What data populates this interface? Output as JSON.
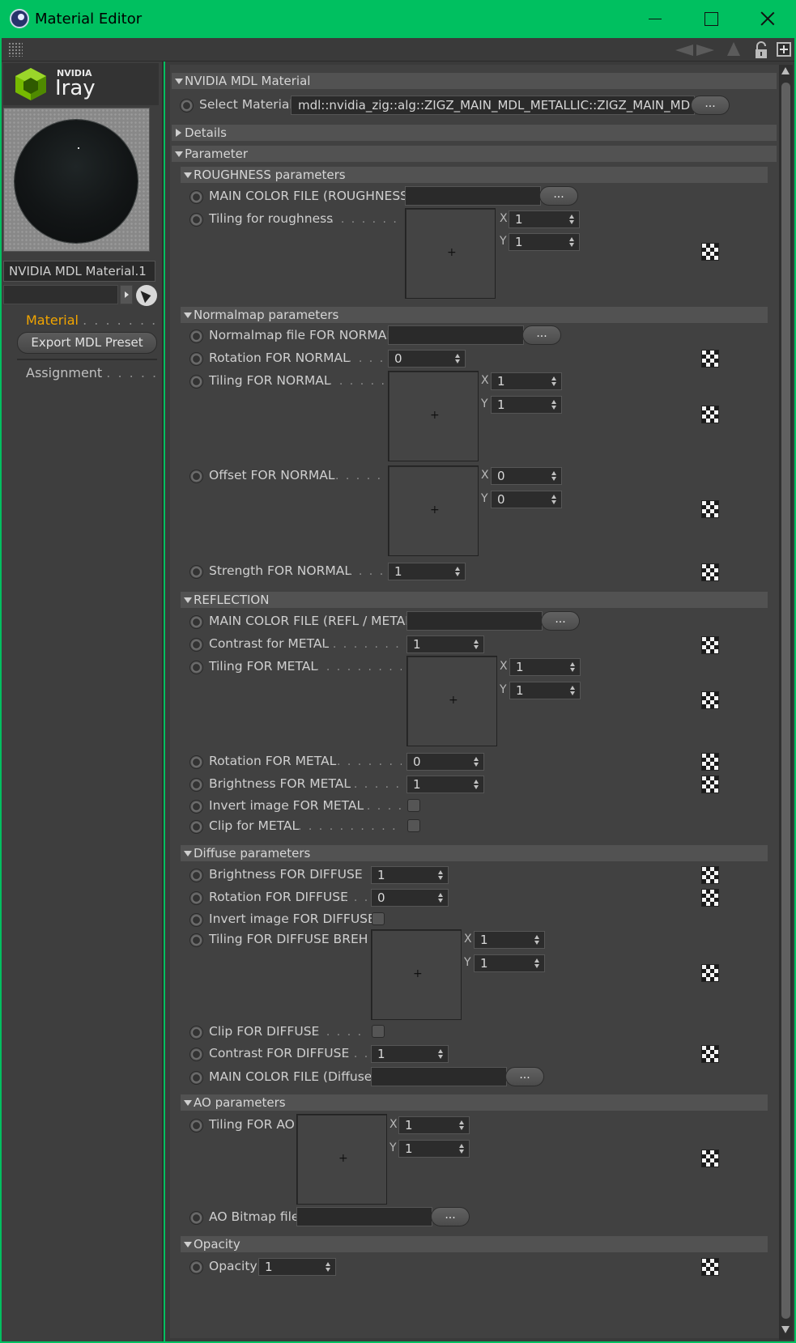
{
  "window": {
    "title": "Material Editor"
  },
  "left": {
    "logo_brand": "NVIDIA",
    "logo_product": "Iray",
    "material_name": "NVIDIA MDL Material.1",
    "nav_material": "Material",
    "nav_assignment": "Assignment",
    "dots_material": ". . . . . . . . .",
    "dots_assignment": ". . . . . . .",
    "export_button": "Export MDL Preset"
  },
  "main": {
    "g_nvidia": "NVIDIA MDL Material",
    "select_material_label": "Select Material",
    "select_material_value": "mdl::nvidia_zig::alg::ZIGZ_MAIN_MDL_METALLIC::ZIGZ_MAIN_MD",
    "ellipsis": "...",
    "g_details": "Details",
    "g_parameter": "Parameter",
    "g_roughness": "ROUGHNESS parameters",
    "g_normal": "Normalmap parameters",
    "g_reflection": "REFLECTION",
    "g_diffuse": "Diffuse parameters",
    "g_ao": "AO parameters",
    "g_opacity": "Opacity",
    "axis_x": "X",
    "axis_y": "Y",
    "plus": "+",
    "params": {
      "r_file": "MAIN COLOR FILE (ROUGHNESS)",
      "r_tiling": "Tiling for roughness",
      "n_file": "Normalmap file FOR NORMAL",
      "n_rotation": "Rotation FOR NORMAL",
      "n_tiling": "Tiling FOR NORMAL",
      "n_offset": "Offset FOR NORMAL",
      "n_strength": "Strength FOR NORMAL",
      "m_file": "MAIN COLOR FILE (REFL / METAL)",
      "m_contrast": "Contrast for METAL",
      "m_tiling": "Tiling FOR METAL",
      "m_rotation": "Rotation FOR METAL",
      "m_brightness": "Brightness FOR METAL",
      "m_invert": "Invert image FOR METAL",
      "m_clip": "Clip for METAL",
      "d_brightness": "Brightness FOR DIFFUSE",
      "d_rotation": "Rotation FOR DIFFUSE",
      "d_invert": "Invert image FOR DIFFUSE",
      "d_tiling": "Tiling FOR DIFFUSE BREH",
      "d_clip": "Clip FOR DIFFUSE",
      "d_contrast": "Contrast FOR DIFFUSE",
      "d_file": "MAIN COLOR FILE (Diffuse)",
      "a_tiling": "Tiling FOR AO",
      "a_file": "AO Bitmap file",
      "o_opacity": "Opacity"
    },
    "values": {
      "r_tiling_x": "1",
      "r_tiling_y": "1",
      "n_rotation": "0",
      "n_tiling_x": "1",
      "n_tiling_y": "1",
      "n_offset_x": "0",
      "n_offset_y": "0",
      "n_strength": "1",
      "m_contrast": "1",
      "m_tiling_x": "1",
      "m_tiling_y": "1",
      "m_rotation": "0",
      "m_brightness": "1",
      "d_brightness": "1",
      "d_rotation": "0",
      "d_tiling_x": "1",
      "d_tiling_y": "1",
      "d_contrast": "1",
      "a_tiling_x": "1",
      "a_tiling_y": "1",
      "o_opacity": "1"
    }
  },
  "colors": {
    "titlebar": "#00c060",
    "panel": "#414141",
    "accent_orange": "#f2a500"
  }
}
